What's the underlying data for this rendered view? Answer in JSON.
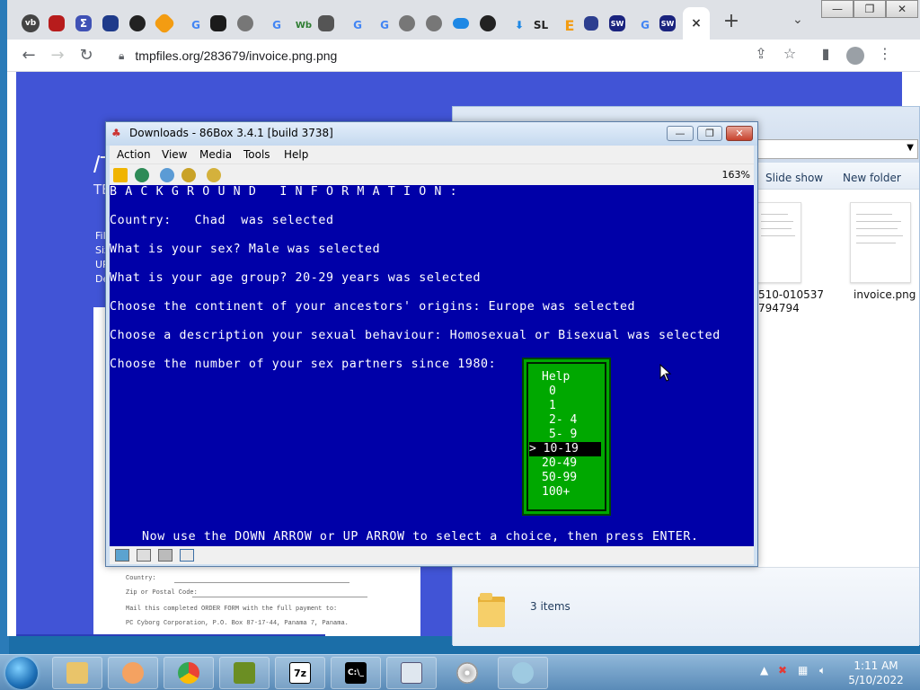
{
  "browser": {
    "url": "tmpfiles.org/283679/invoice.png.png",
    "tabs": [
      "vb",
      "",
      "Σ",
      "",
      "",
      "",
      "G",
      "",
      "",
      "G",
      "Wb",
      "",
      "G",
      "G",
      "",
      "",
      "",
      "",
      "",
      "",
      "SL",
      "E",
      "",
      "SW",
      "G",
      "SW",
      "×"
    ],
    "new_tab": "+",
    "tab_search": "⌄"
  },
  "page": {
    "title": "/T",
    "subtitle": "TE",
    "meta": [
      "File",
      "Size",
      "URL",
      "Dele"
    ],
    "invoice_lines": [
      "Country:",
      "Zip or Postal Code:",
      "Mail this completed ORDER FORM with the full payment to:",
      "PC Cyborg Corporation, P.O. Box 87-17-44, Panama 7, Panama."
    ]
  },
  "explorer": {
    "commands": [
      "Slide show",
      "New folder"
    ],
    "files": [
      {
        "name_line1": "510-010537",
        "name_line2": "794794"
      },
      {
        "name_line1": "invoice.png",
        "name_line2": ""
      }
    ],
    "status": "3 items"
  },
  "vm": {
    "title": "Downloads - 86Box 3.4.1 [build 3738]",
    "menu": [
      "Action",
      "View",
      "Media",
      "Tools",
      "Help"
    ],
    "zoom": "163%",
    "screen": {
      "heading": "B A C K G R O U N D   I N F O R M A T I O N :",
      "lines": [
        "Country:   Chad  was selected",
        "What is your sex? Male was selected",
        "What is your age group? 20-29 years was selected",
        "Choose the continent of your ancestors' origins: Europe was selected",
        "Choose a description your sexual behaviour: Homosexual or Bisexual was selected",
        "Choose the number of your sex partners since 1980:"
      ],
      "menu_options": [
        "Help",
        "0",
        "1",
        "2- 4",
        "5- 9",
        "> 10-19",
        "20-49",
        "50-99",
        "100+"
      ],
      "selected_index": 5,
      "footer": "Now use the DOWN ARROW or UP ARROW to select a choice, then press ENTER."
    }
  },
  "taskbar": {
    "clock_time": "1:11 AM",
    "clock_date": "5/10/2022",
    "apps": [
      "explorer",
      "media",
      "chrome",
      "86box",
      "7z",
      "cmd",
      "notepad",
      "cd",
      "paint"
    ]
  },
  "colors": {
    "page_bg": "#4154d6",
    "dos_bg": "#0000a8",
    "dos_menu": "#00a800"
  }
}
